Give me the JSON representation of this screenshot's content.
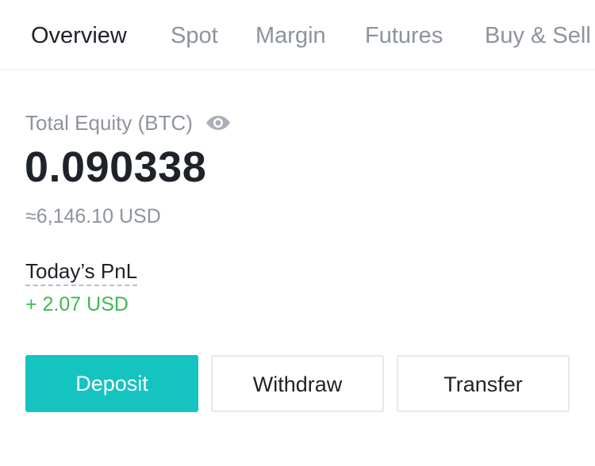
{
  "tabs": [
    {
      "label": "Overview",
      "active": true
    },
    {
      "label": "Spot",
      "active": false
    },
    {
      "label": "Margin",
      "active": false
    },
    {
      "label": "Futures",
      "active": false
    },
    {
      "label": "Buy & Sell",
      "active": false
    }
  ],
  "equity": {
    "label": "Total Equity (BTC)",
    "visibility_icon": "eye-icon",
    "value": "0.090338",
    "fiat_equivalent": "≈6,146.10 USD"
  },
  "pnl": {
    "label": "Today’s PnL",
    "value": "+ 2.07 USD",
    "color": "#3fb950"
  },
  "actions": {
    "deposit_label": "Deposit",
    "withdraw_label": "Withdraw",
    "transfer_label": "Transfer"
  },
  "colors": {
    "primary": "#15c3c1",
    "text_primary": "#1e2329",
    "text_secondary": "#8d949c",
    "positive": "#3fb950"
  }
}
